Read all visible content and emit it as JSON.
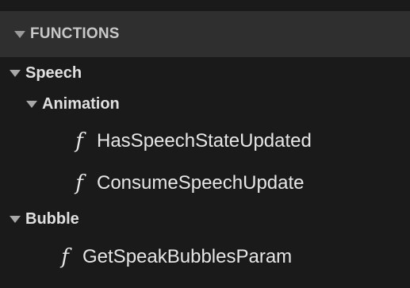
{
  "header": {
    "title": "FUNCTIONS",
    "icon": "triangle-down-icon"
  },
  "tree": {
    "categories": [
      {
        "label": "Speech",
        "expanded": true,
        "subcategories": [
          {
            "label": "Animation",
            "expanded": true,
            "functions": [
              {
                "icon": "f",
                "label": "HasSpeechStateUpdated"
              },
              {
                "icon": "f",
                "label": "ConsumeSpeechUpdate"
              }
            ]
          }
        ]
      },
      {
        "label": "Bubble",
        "expanded": true,
        "functions": [
          {
            "icon": "f",
            "label": "GetSpeakBubblesParam"
          }
        ]
      }
    ]
  },
  "colors": {
    "background": "#1a1a1a",
    "header_background": "#2f2f2f",
    "text": "#e6e6e6",
    "header_text": "#c8c8c8"
  }
}
